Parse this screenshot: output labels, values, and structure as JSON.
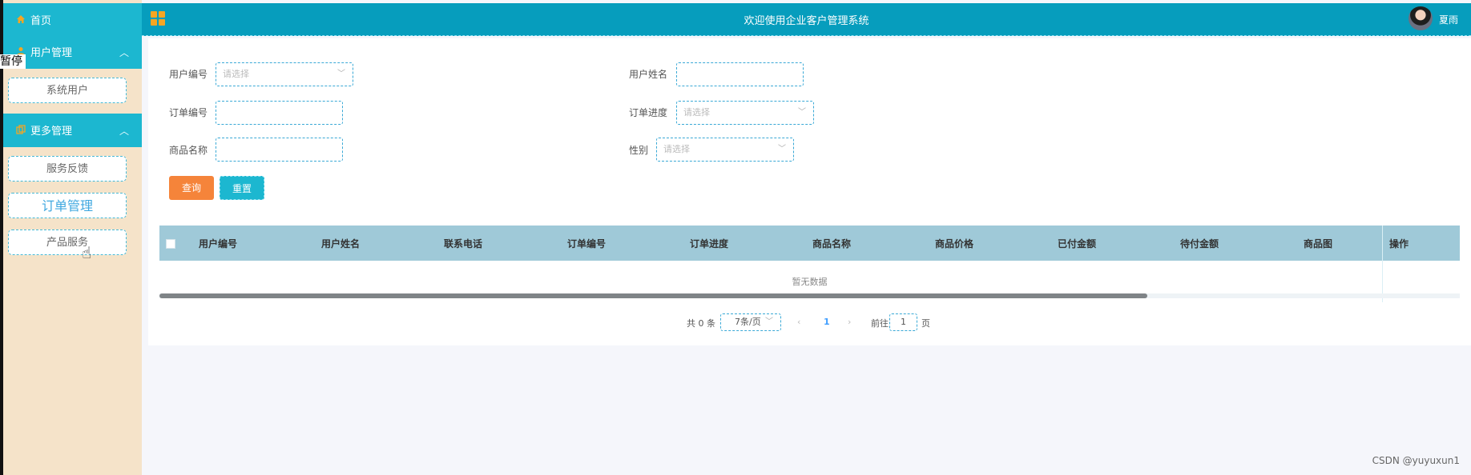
{
  "header": {
    "title": "欢迎使用企业客户管理系统",
    "username": "夏雨"
  },
  "sidebar": {
    "home": "首页",
    "groups": [
      {
        "label": "用户管理",
        "items": [
          "系统用户"
        ]
      },
      {
        "label": "更多管理",
        "items": [
          "服务反馈",
          "订单管理",
          "产品服务"
        ]
      }
    ],
    "overlay_text": "暂停"
  },
  "form": {
    "user_no_label": "用户编号",
    "user_no_placeholder": "请选择",
    "user_name_label": "用户姓名",
    "order_no_label": "订单编号",
    "order_progress_label": "订单进度",
    "order_progress_placeholder": "请选择",
    "product_name_label": "商品名称",
    "gender_label": "性别",
    "gender_placeholder": "请选择",
    "query_button": "查询",
    "reset_button": "重置"
  },
  "table": {
    "columns": [
      "用户编号",
      "用户姓名",
      "联系电话",
      "订单编号",
      "订单进度",
      "商品名称",
      "商品价格",
      "已付金额",
      "待付金额",
      "商品图",
      "操作"
    ],
    "empty_text": "暂无数据"
  },
  "pagination": {
    "total_text": "共 0 条",
    "page_size": "7条/页",
    "current_page": "1",
    "goto_label": "前往",
    "goto_value": "1",
    "page_suffix": "页"
  },
  "watermark": "CSDN @yuyuxun1",
  "colors": {
    "header": "#069dbd",
    "sidebar_head": "#1cb7d0",
    "sidebar_bg": "#f5e3c9",
    "query": "#f5843a",
    "table_head": "#9fc9d8"
  }
}
